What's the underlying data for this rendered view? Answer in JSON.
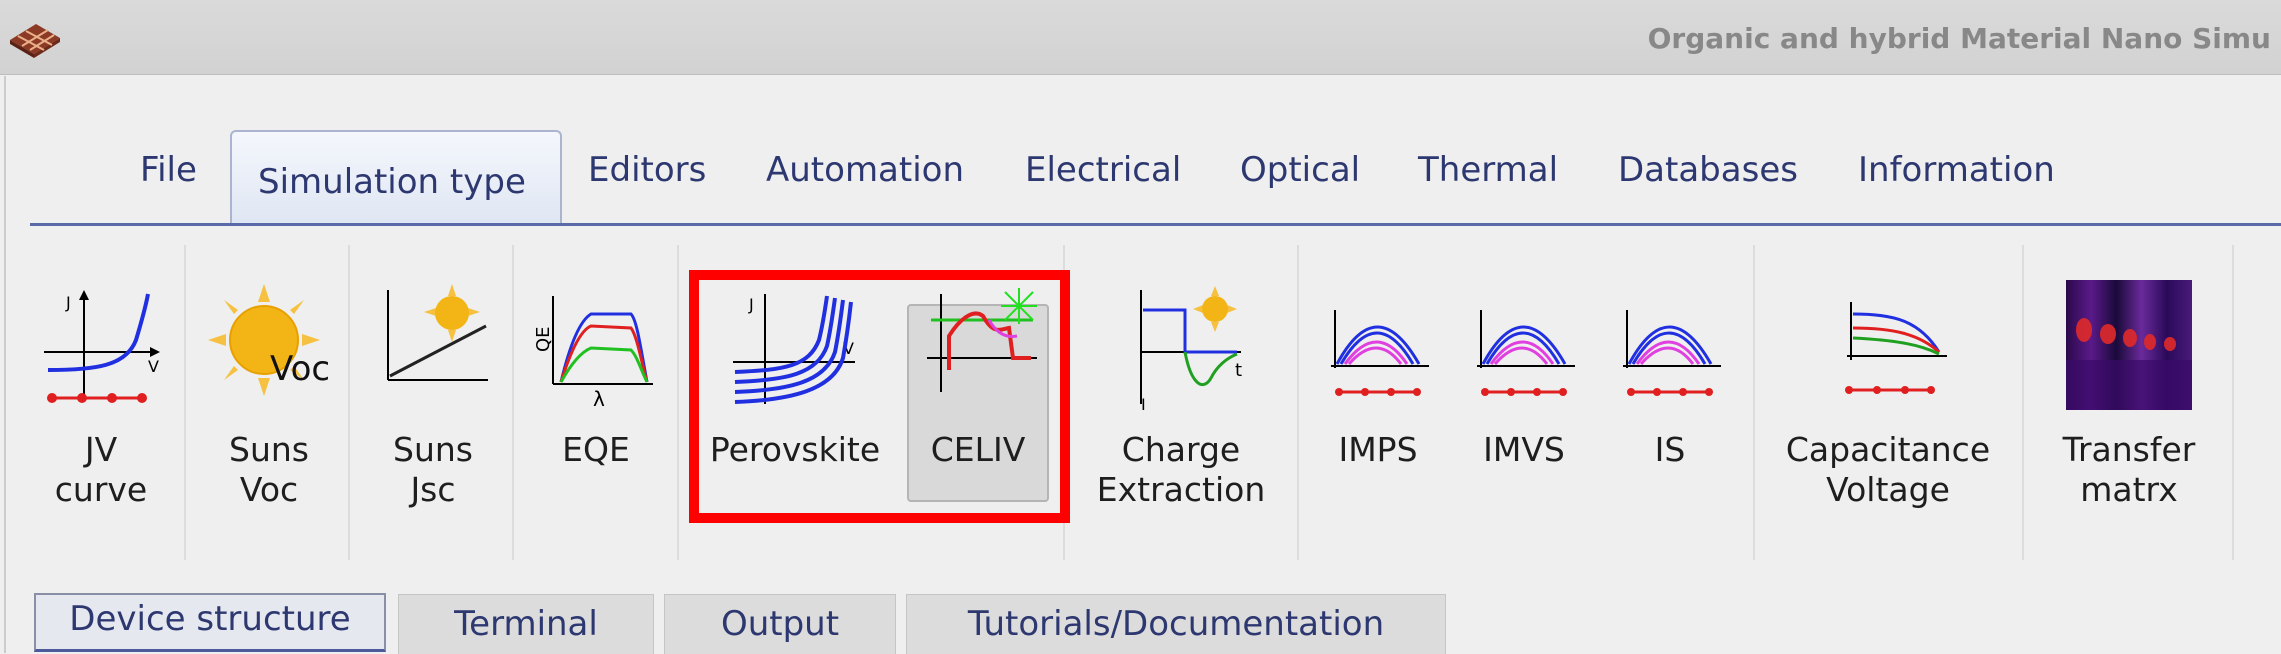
{
  "window": {
    "title": "Organic and hybrid Material Nano Simu"
  },
  "menu": {
    "items": [
      "File",
      "Simulation type",
      "Editors",
      "Automation",
      "Electrical",
      "Optical",
      "Thermal",
      "Databases",
      "Information"
    ],
    "active": "Simulation type"
  },
  "tools": {
    "jv": {
      "label": "JV\ncurve",
      "icon": "jv-curve-icon"
    },
    "suns_voc": {
      "label": "Suns\nVoc",
      "icon_text": "Voc",
      "icon": "sun-icon"
    },
    "suns_jsc": {
      "label": "Suns\nJsc",
      "icon": "suns-jsc-icon"
    },
    "eqe": {
      "label": "EQE",
      "icon": "eqe-icon",
      "y_axis": "QE",
      "x_axis": "λ"
    },
    "perovskite": {
      "label": "Perovskite",
      "icon": "perovskite-icon",
      "y_axis": "J",
      "x_axis": "V"
    },
    "celiv": {
      "label": "CELIV",
      "icon": "celiv-icon",
      "pressed": true
    },
    "charge_extraction": {
      "label": "Charge\nExtraction",
      "icon": "charge-extraction-icon",
      "y_axis": "J",
      "x_axis": "t"
    },
    "imps": {
      "label": "IMPS",
      "icon": "imps-icon"
    },
    "imvs": {
      "label": "IMVS",
      "icon": "imvs-icon"
    },
    "is": {
      "label": "IS",
      "icon": "is-icon"
    },
    "cv": {
      "label": "Capacitance\nVoltage",
      "icon": "capacitance-voltage-icon"
    },
    "transfer": {
      "label": "Transfer\nmatrx",
      "icon": "transfer-matrix-icon"
    }
  },
  "bottom_tabs": [
    "Device structure",
    "Terminal",
    "Output",
    "Tutorials/Documentation"
  ],
  "colors": {
    "highlight": "#ff0000",
    "menu_line": "#5a6aa8"
  }
}
